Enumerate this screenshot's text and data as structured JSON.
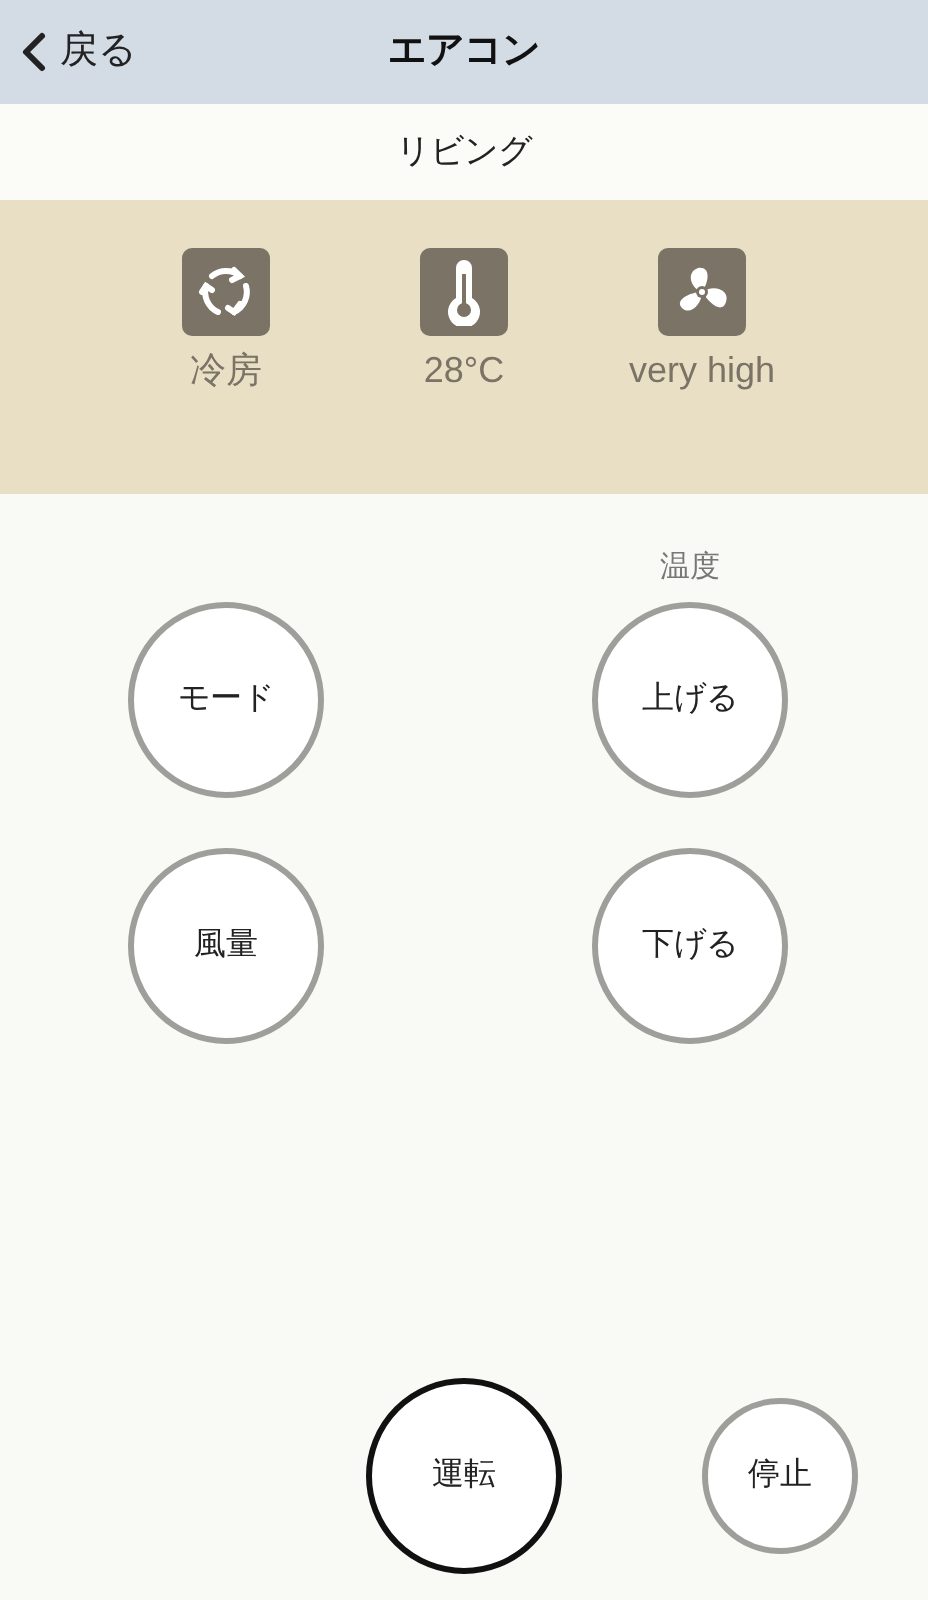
{
  "header": {
    "back_label": "戻る",
    "title": "エアコン"
  },
  "room": "リビング",
  "status": [
    {
      "kind": "mode",
      "label": "冷房"
    },
    {
      "kind": "temperature",
      "label": "28°C"
    },
    {
      "kind": "fan",
      "label": "very high"
    }
  ],
  "controls": {
    "temperature_label": "温度",
    "mode_button": "モード",
    "fan_button": "風量",
    "up_button": "上げる",
    "down_button": "下げる"
  },
  "power": [
    {
      "label": "運転",
      "kind": "primary"
    },
    {
      "label": "停止",
      "kind": "secondary"
    }
  ]
}
